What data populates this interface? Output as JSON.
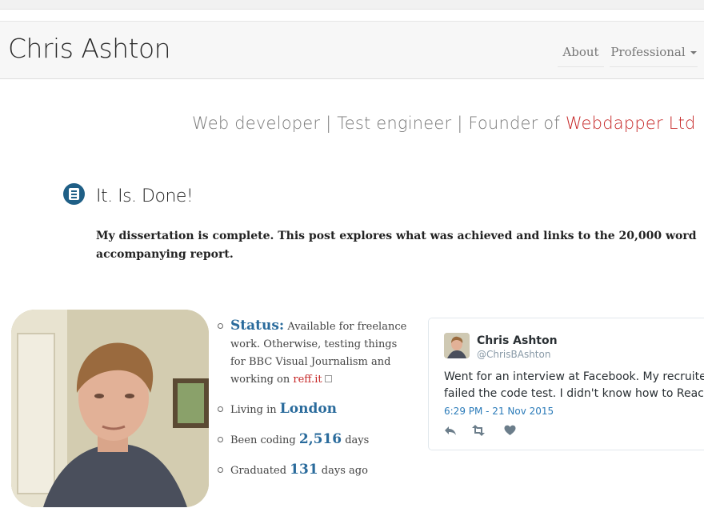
{
  "header": {
    "brand": "Chris Ashton",
    "nav": {
      "about": "About",
      "professional": "Professional"
    }
  },
  "tagline": {
    "text": "Web developer | Test engineer | Founder of ",
    "company": "Webdapper Ltd"
  },
  "post": {
    "icon": "document-icon",
    "title": "It. Is. Done!",
    "excerpt": "My dissertation is complete. This post explores what was achieved and links to the 20,000 word accompanying report."
  },
  "profile": {
    "status_label": "Status:",
    "status_text_1": " Available for freelance work. Otherwise, testing things for BBC Visual Journalism and working on ",
    "status_link": "reff.it",
    "living_prefix": "Living in ",
    "living_city": "London",
    "coding_prefix": "Been coding ",
    "coding_days": "2,516",
    "coding_suffix": " days",
    "graduated_prefix": "Graduated ",
    "graduated_days": "131",
    "graduated_suffix": " days ago"
  },
  "tweet": {
    "name": "Chris Ashton",
    "handle": "@ChrisBAshton",
    "text_line1": "Went for an interview at Facebook. My recruiter cal",
    "text_line2": "failed the code test. I didn't know how to React.",
    "date": "6:29 PM - 21 Nov 2015",
    "actions": [
      "reply-icon",
      "retweet-icon",
      "like-icon"
    ]
  },
  "colors": {
    "accent_blue": "#2a6b9c",
    "accent_red": "#c62828",
    "post_icon": "#1f5f86"
  }
}
